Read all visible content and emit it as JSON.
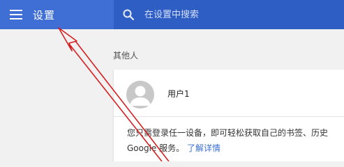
{
  "header": {
    "title": "设置",
    "menu_icon": "hamburger-menu-icon"
  },
  "search": {
    "placeholder": "在设置中搜索",
    "icon": "search-icon"
  },
  "section": {
    "title": "其他人"
  },
  "person": {
    "avatar_icon": "person-avatar-icon",
    "name": "用户1",
    "description_line1": "您只需登录任一设备，即可轻松获取自己的书签、历史",
    "description_line2": "Google 服务。",
    "learn_more": "了解详情"
  },
  "annotation": {
    "arrow_icon": "red-arrow-annotation-icon",
    "color": "#d42020"
  },
  "colors": {
    "header": "#3f6fd4",
    "search_bg": "#2e5ec4",
    "link": "#3b6fd4",
    "background": "#f1f1f1"
  }
}
